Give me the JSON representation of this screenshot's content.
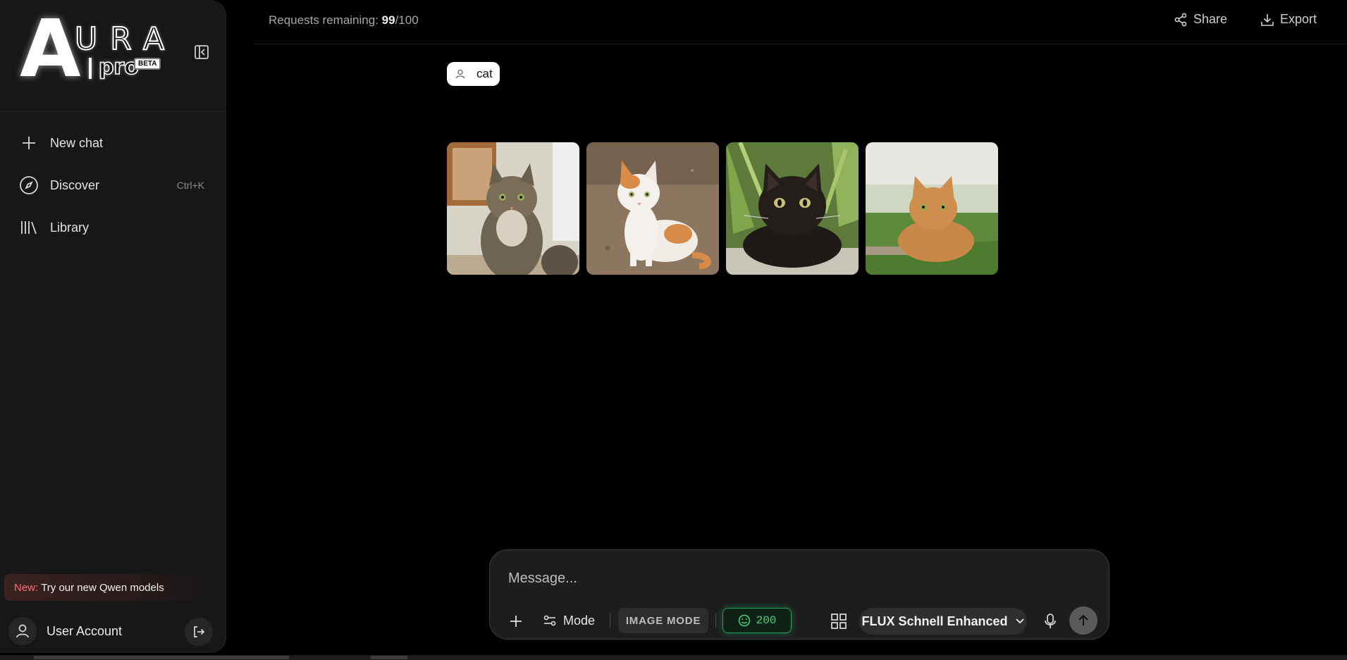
{
  "app": {
    "logo_letter": "A",
    "logo_word": "URA",
    "logo_sub": "pro",
    "logo_badge": "BETA"
  },
  "sidebar": {
    "items": [
      {
        "label": "New chat",
        "icon": "plus-icon"
      },
      {
        "label": "Discover",
        "icon": "compass-icon",
        "shortcut": "Ctrl+K"
      },
      {
        "label": "Library",
        "icon": "library-icon"
      }
    ],
    "promo": {
      "tag": "New:",
      "text": "Try our new Qwen models"
    },
    "account": {
      "name": "User Account"
    }
  },
  "header": {
    "requests_label": "Requests remaining:",
    "requests_used": "99",
    "requests_total": "/100",
    "share_label": "Share",
    "export_label": "Export"
  },
  "chat": {
    "user_message": "cat",
    "images": [
      {
        "alt": "tabby cat sitting by window"
      },
      {
        "alt": "orange and white cat sitting on dirt"
      },
      {
        "alt": "black cat lying in plants"
      },
      {
        "alt": "orange cat crouching on grass"
      }
    ]
  },
  "composer": {
    "placeholder": "Message...",
    "mode_label": "Mode",
    "image_mode_label": "IMAGE MODE",
    "credits": "200",
    "model": "FLUX Schnell Enhanced"
  },
  "colors": {
    "accent_green": "#42d67e",
    "promo_red": "#ff6d6d",
    "sidebar_bg": "#171717"
  }
}
